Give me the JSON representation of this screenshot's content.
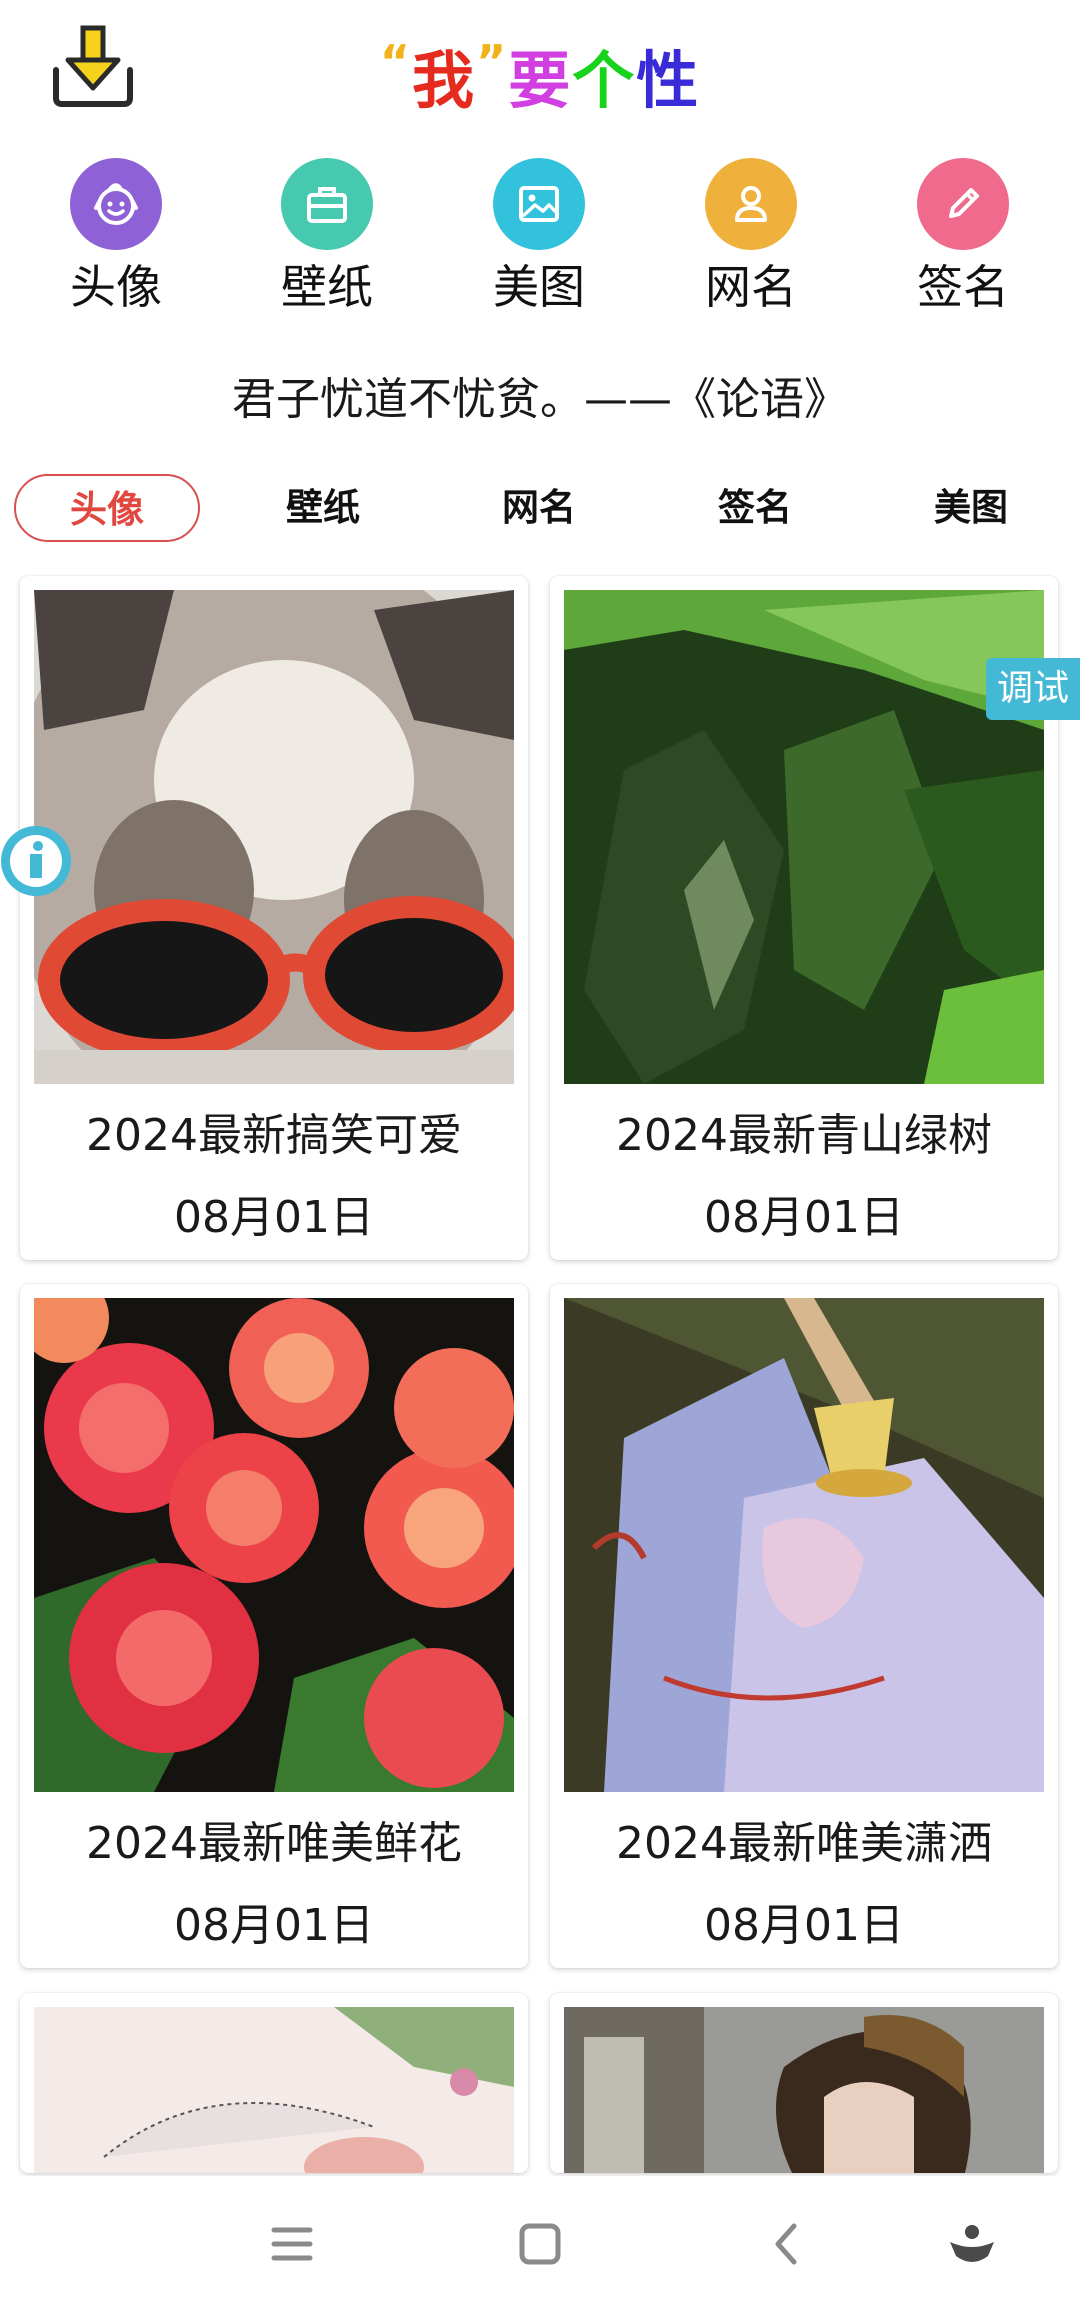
{
  "header": {
    "title_quote_open": "“",
    "title_wo": "我",
    "title_quote_close": "”",
    "title_yao": "要",
    "title_ge": "个",
    "title_xing": "性",
    "title_colors": {
      "quote": "#f2b21b",
      "wo": "#e52a1e",
      "yao": "#d23fe0",
      "ge": "#18d21b",
      "xing": "#3a2bd9"
    },
    "download_icon": "download-tray-icon"
  },
  "categories": [
    {
      "label": "头像",
      "icon": "baby-face-icon",
      "color": "#8e62d6"
    },
    {
      "label": "壁纸",
      "icon": "briefcase-icon",
      "color": "#47c9b0"
    },
    {
      "label": "美图",
      "icon": "image-icon",
      "color": "#32c2dc"
    },
    {
      "label": "网名",
      "icon": "person-icon",
      "color": "#efb13b"
    },
    {
      "label": "签名",
      "icon": "pen-icon",
      "color": "#ef6a8d"
    }
  ],
  "quote": "君子忧道不忧贫。——《论语》",
  "tabs": [
    {
      "label": "头像",
      "active": true
    },
    {
      "label": "壁纸",
      "active": false
    },
    {
      "label": "网名",
      "active": false
    },
    {
      "label": "签名",
      "active": false
    },
    {
      "label": "美图",
      "active": false
    }
  ],
  "cards": [
    {
      "title": "2024最新搞笑可爱",
      "date": "08月01日",
      "image": "cat-with-red-sunglasses"
    },
    {
      "title": "2024最新青山绿树",
      "date": "08月01日",
      "image": "green-mountain-forest"
    },
    {
      "title": "2024最新唯美鲜花",
      "date": "08月01日",
      "image": "red-pink-roses"
    },
    {
      "title": "2024最新唯美潇洒",
      "date": "08月01日",
      "image": "anime-girl-with-bell"
    }
  ],
  "floating": {
    "debug_label": "调试",
    "debug_color": "#43b9d6",
    "info_icon": "info-icon"
  },
  "navbar": {
    "icons": [
      "menu-icon",
      "home-square-icon",
      "back-chevron-icon",
      "assistant-icon"
    ]
  }
}
